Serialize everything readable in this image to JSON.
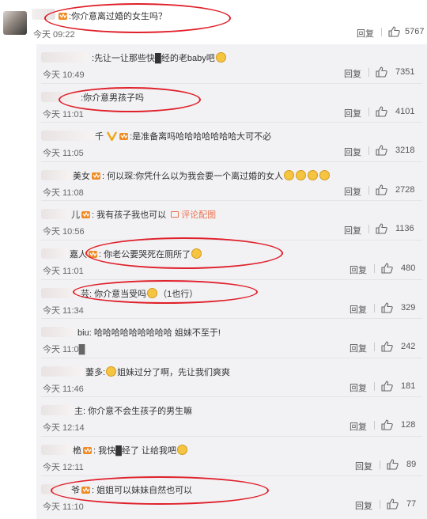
{
  "top_comment": {
    "body": "你介意离过婚的女生吗？",
    "time": "今天 09:22",
    "reply": "回复",
    "likes": "5767"
  },
  "replies": [
    {
      "body": "先让一让那些快█经的老baby吧",
      "time": "今天 10:49",
      "reply": "回复",
      "likes": "7351"
    },
    {
      "body": "你介意男孩子吗",
      "time": "今天 11:01",
      "reply": "回复",
      "likes": "4101"
    },
    {
      "body": "是准备离吗哈哈哈哈哈哈哈大可不必",
      "time": "今天 11:05",
      "reply": "回复",
      "likes": "3218"
    },
    {
      "body": "何以琛:你凭什么以为我会要一个离过婚的女人",
      "time": "今天 11:08",
      "reply": "回复",
      "likes": "2728"
    },
    {
      "body": "我有孩子我也可以",
      "pic_link": "评论配图",
      "time": "今天 10:56",
      "reply": "回复",
      "likes": "1136"
    },
    {
      "body": "你老公要哭死在厕所了",
      "time": "今天 11:01",
      "reply": "回复",
      "likes": "480"
    },
    {
      "body": "你介意当受吗",
      "extra": "（1也行）",
      "time": "今天 11:34",
      "reply": "回复",
      "likes": "329"
    },
    {
      "body": "哈哈哈哈哈哈哈哈哈 姐妹不至于!",
      "time": "今天 11:0█",
      "reply": "回复",
      "likes": "242"
    },
    {
      "body": "姐妹过分了啊，先让我们爽爽",
      "time": "今天 11:46",
      "reply": "回复",
      "likes": "181"
    },
    {
      "body": "你介意不会生孩子的男生嘛",
      "time": "今天 12:14",
      "reply": "回复",
      "likes": "128"
    },
    {
      "body": "我快█经了 让给我吧",
      "time": "今天 12:11",
      "reply": "回复",
      "likes": "89"
    },
    {
      "body": "姐姐可以妹妹自然也可以",
      "time": "今天 11:10",
      "reply": "回复",
      "likes": "77"
    }
  ],
  "name_fragments": [
    "千",
    "美女",
    "儿",
    "嘉人",
    "芸",
    "biu",
    "萋多",
    "主",
    "桅",
    "爷"
  ],
  "colors": {
    "highlight": "#e0202a",
    "background": "#f2f2f5"
  },
  "icons": [
    "like-icon",
    "vip-badge-icon",
    "emoji-icon",
    "image-icon"
  ]
}
